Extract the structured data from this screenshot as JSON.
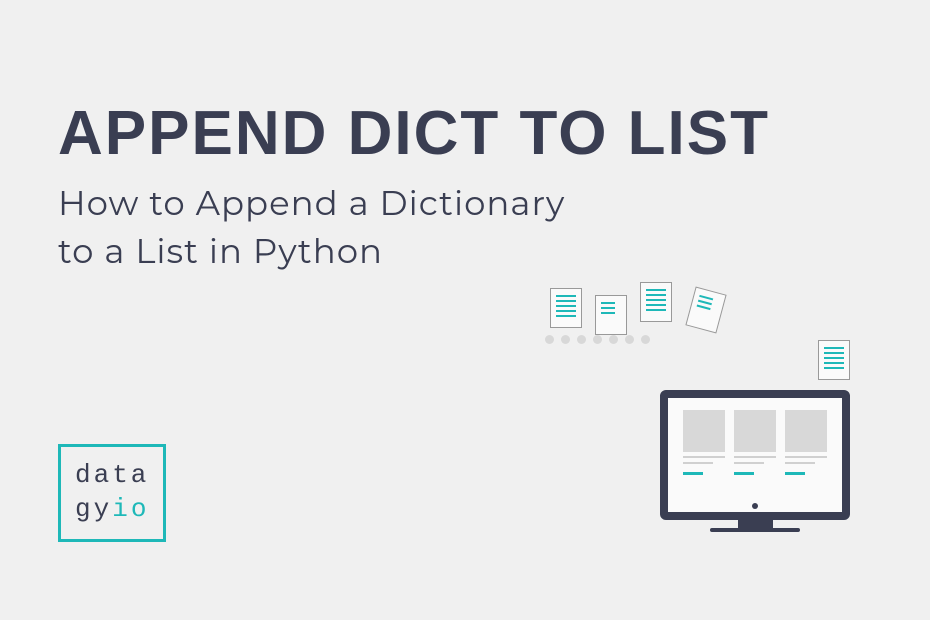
{
  "title": "APPEND DICT TO LIST",
  "subtitle_line1": "How to Append a Dictionary",
  "subtitle_line2": "to a List in Python",
  "logo": {
    "row1": "data",
    "row2_part1": "gy",
    "row2_part2": "io"
  },
  "colors": {
    "background": "#f0f0f0",
    "text": "#3a3e52",
    "accent": "#1eb8b8"
  }
}
